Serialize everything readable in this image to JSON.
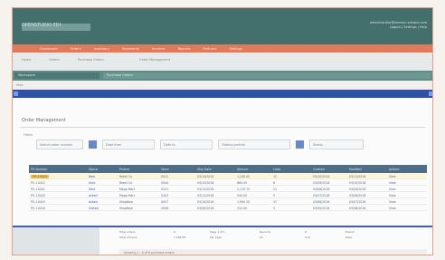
{
  "header": {
    "logo_text": "OPENSTUDIO EDI",
    "user_line1": "administrator@domain-sample.com",
    "user_line2": "Logout | Settings | Help"
  },
  "nav": {
    "items": [
      "Dashboard",
      "Orders",
      "Inventory",
      "Shipments",
      "Invoices",
      "Reports",
      "Partners",
      "Settings"
    ]
  },
  "breadcrumb": {
    "items": [
      "Home",
      "Orders",
      "Purchase Orders",
      "Order Management"
    ]
  },
  "toolbar": {
    "left_label": "Workspace",
    "right_label": "Purchase Orders"
  },
  "subbar": {
    "label": "Main"
  },
  "page": {
    "title": "Order Management",
    "filter_label": "Filters"
  },
  "filters": {
    "search_placeholder": "Search order number",
    "date_from": "Date from",
    "date_to": "Date to",
    "partner": "Trading partner",
    "status": "Status"
  },
  "table": {
    "columns": [
      "PO Number",
      "Status",
      "Partner",
      "Store",
      "Ship Date",
      "Amount",
      "Lines",
      "Created",
      "Modified",
      "Actions"
    ],
    "rows": [
      [
        "PO-10423",
        "New",
        "Retail Co",
        "0012",
        "03/14/2018",
        "1,240.00",
        "12",
        "03/10/2018",
        "03/11/2018",
        "View"
      ],
      [
        "PO-10422",
        "Sent",
        "Retail Co",
        "0044",
        "03/13/2018",
        "860.50",
        "8",
        "03/09/2018",
        "03/10/2018",
        "View"
      ],
      [
        "PO-10421",
        "Sent",
        "Mega Mart",
        "0101",
        "03/12/2018",
        "2,115.75",
        "21",
        "03/08/2018",
        "03/09/2018",
        "View"
      ],
      [
        "PO-10420",
        "Acked",
        "Mega Mart",
        "0102",
        "03/11/2018",
        "540.00",
        "5",
        "03/07/2018",
        "03/08/2018",
        "View"
      ],
      [
        "PO-10419",
        "Acked",
        "ShopNow",
        "0007",
        "03/10/2018",
        "1,990.20",
        "17",
        "03/06/2018",
        "03/07/2018",
        "View"
      ],
      [
        "PO-10418",
        "Closed",
        "ShopNow",
        "0008",
        "03/09/2018",
        "310.40",
        "3",
        "03/05/2018",
        "03/06/2018",
        "View"
      ]
    ]
  },
  "footer": {
    "rows": [
      [
        "Total orders",
        "6",
        "Page 1 of 1",
        "Records",
        "6",
        "Export"
      ],
      [
        "Total amount",
        "7,066.85",
        "Per page",
        "25",
        "Sort",
        "Date"
      ]
    ],
    "summary": "Showing 1 - 6 of 6 purchase orders"
  }
}
